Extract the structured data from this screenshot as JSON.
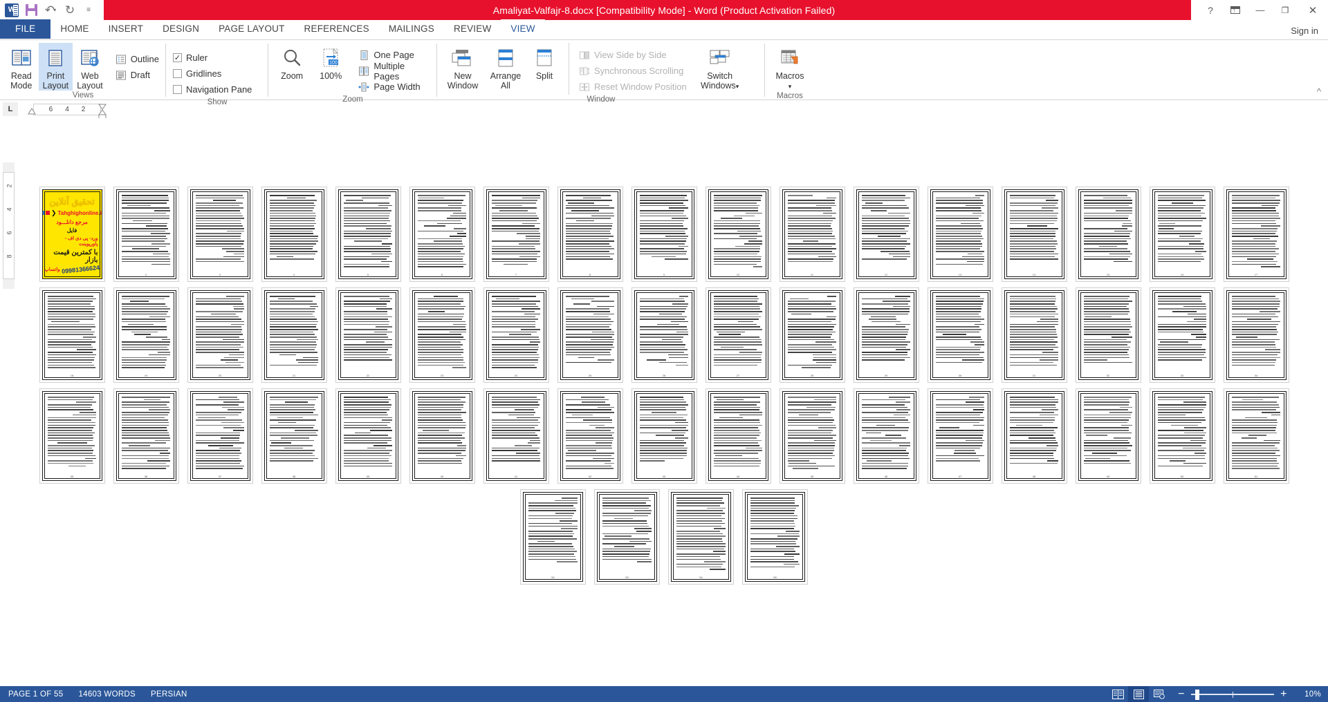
{
  "titlebar": {
    "quick_access": [
      {
        "name": "word-logo-icon",
        "label": "W"
      },
      {
        "name": "save-icon",
        "label": "Save"
      },
      {
        "name": "undo-icon",
        "label": "Undo"
      },
      {
        "name": "redo-icon",
        "label": "Redo"
      },
      {
        "name": "customize-quick-access-icon",
        "label": "Customize Quick Access Toolbar"
      }
    ],
    "title": "Amaliyat-Valfajr-8.docx [Compatibility Mode]  -  Word (Product Activation Failed)",
    "window_buttons": {
      "help": "?",
      "ribbon_display_options": "Ribbon Display Options",
      "minimize": "—",
      "restore": "❐",
      "close": "✕"
    }
  },
  "tabs": {
    "file": "FILE",
    "items": [
      {
        "label": "HOME",
        "active": false
      },
      {
        "label": "INSERT",
        "active": false
      },
      {
        "label": "DESIGN",
        "active": false
      },
      {
        "label": "PAGE LAYOUT",
        "active": false
      },
      {
        "label": "REFERENCES",
        "active": false
      },
      {
        "label": "MAILINGS",
        "active": false
      },
      {
        "label": "REVIEW",
        "active": false
      },
      {
        "label": "VIEW",
        "active": true
      }
    ],
    "signin": "Sign in"
  },
  "ribbon": {
    "collapse": "^",
    "groups": [
      {
        "name": "views",
        "label": "Views",
        "big_buttons": [
          {
            "name": "read-mode-button",
            "line1": "Read",
            "line2": "Mode",
            "selected": false
          },
          {
            "name": "print-layout-button",
            "line1": "Print",
            "line2": "Layout",
            "selected": true
          },
          {
            "name": "web-layout-button",
            "line1": "Web",
            "line2": "Layout",
            "selected": false
          }
        ],
        "small_buttons": [
          {
            "name": "outline-button",
            "label": "Outline"
          },
          {
            "name": "draft-button",
            "label": "Draft"
          }
        ]
      },
      {
        "name": "show",
        "label": "Show",
        "checkboxes": [
          {
            "name": "ruler-checkbox",
            "label": "Ruler",
            "checked": true
          },
          {
            "name": "gridlines-checkbox",
            "label": "Gridlines",
            "checked": false
          },
          {
            "name": "navigation-pane-checkbox",
            "label": "Navigation Pane",
            "checked": false
          }
        ]
      },
      {
        "name": "zoom",
        "label": "Zoom",
        "big_buttons": [
          {
            "name": "zoom-button",
            "line1": "Zoom",
            "line2": ""
          },
          {
            "name": "zoom-100-button",
            "line1": "100%",
            "line2": ""
          }
        ],
        "small_buttons": [
          {
            "name": "one-page-button",
            "label": "One Page"
          },
          {
            "name": "multiple-pages-button",
            "label": "Multiple Pages"
          },
          {
            "name": "page-width-button",
            "label": "Page Width"
          }
        ]
      },
      {
        "name": "window",
        "label": "Window",
        "big_buttons": [
          {
            "name": "new-window-button",
            "line1": "New",
            "line2": "Window"
          },
          {
            "name": "arrange-all-button",
            "line1": "Arrange",
            "line2": "All"
          },
          {
            "name": "split-button",
            "line1": "Split",
            "line2": ""
          }
        ],
        "small_buttons": [
          {
            "name": "view-side-by-side-button",
            "label": "View Side by Side",
            "disabled": true
          },
          {
            "name": "synchronous-scrolling-button",
            "label": "Synchronous Scrolling",
            "disabled": true
          },
          {
            "name": "reset-window-position-button",
            "label": "Reset Window Position",
            "disabled": true
          }
        ],
        "switch_windows": {
          "name": "switch-windows-button",
          "line1": "Switch",
          "line2": "Windows",
          "caret": "▾"
        }
      },
      {
        "name": "macros",
        "label": "Macros",
        "big_buttons": [
          {
            "name": "macros-button",
            "line1": "Macros",
            "line2": "▾"
          }
        ]
      }
    ]
  },
  "rulers": {
    "tab_stop_indicator": "L",
    "horizontal_marks": [
      "6",
      "4",
      "2"
    ],
    "vertical_marks": [
      "2",
      "4",
      "6",
      "8"
    ]
  },
  "document": {
    "ad_page": {
      "title": "تحقیق آنلاین",
      "url": "Tahghighonline.ir",
      "line1": "مرجع دانلـــود",
      "line2": "فایل",
      "line3": "ورد- پی دی اف - پاورپوینت",
      "line4": "با کمترین قیمت بازار",
      "phone": "09981366624",
      "whatsapp": "واتساپ"
    },
    "total_pages": 55,
    "pages_per_row": 17,
    "rows": [
      17,
      17,
      17,
      4
    ]
  },
  "statusbar": {
    "page": "PAGE 1 OF 55",
    "words": "14603 WORDS",
    "language": "PERSIAN",
    "view_buttons": [
      {
        "name": "read-mode-view-button",
        "active": false
      },
      {
        "name": "print-layout-view-button",
        "active": true
      },
      {
        "name": "web-layout-view-button",
        "active": false
      }
    ],
    "zoom_out": "−",
    "zoom_in": "+",
    "zoom_value": "10%"
  },
  "colors": {
    "title_red": "#e8112d",
    "word_blue": "#2b579a",
    "ribbon_selected": "#cde0f5",
    "ad_yellow": "#ffe600"
  }
}
